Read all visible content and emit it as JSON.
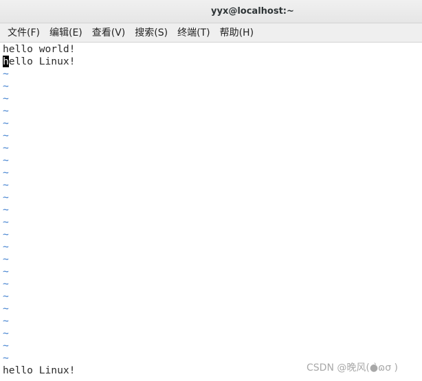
{
  "window": {
    "title": "yyx@localhost:~"
  },
  "menu": {
    "items": [
      "文件(F)",
      "编辑(E)",
      "查看(V)",
      "搜索(S)",
      "终端(T)",
      "帮助(H)"
    ]
  },
  "editor": {
    "line1": "hello world!",
    "line2_cursor_char": "h",
    "line2_rest": "ello Linux!",
    "empty_marker": "~",
    "empty_line_count": 24
  },
  "command_line": {
    "text": "hello Linux!"
  },
  "watermark": {
    "text": "CSDN @晚风(●̀ɷσ )"
  },
  "colors": {
    "tilde": "#3f7fcf",
    "cursor_bg": "#000000",
    "text": "#2b2b2b"
  }
}
